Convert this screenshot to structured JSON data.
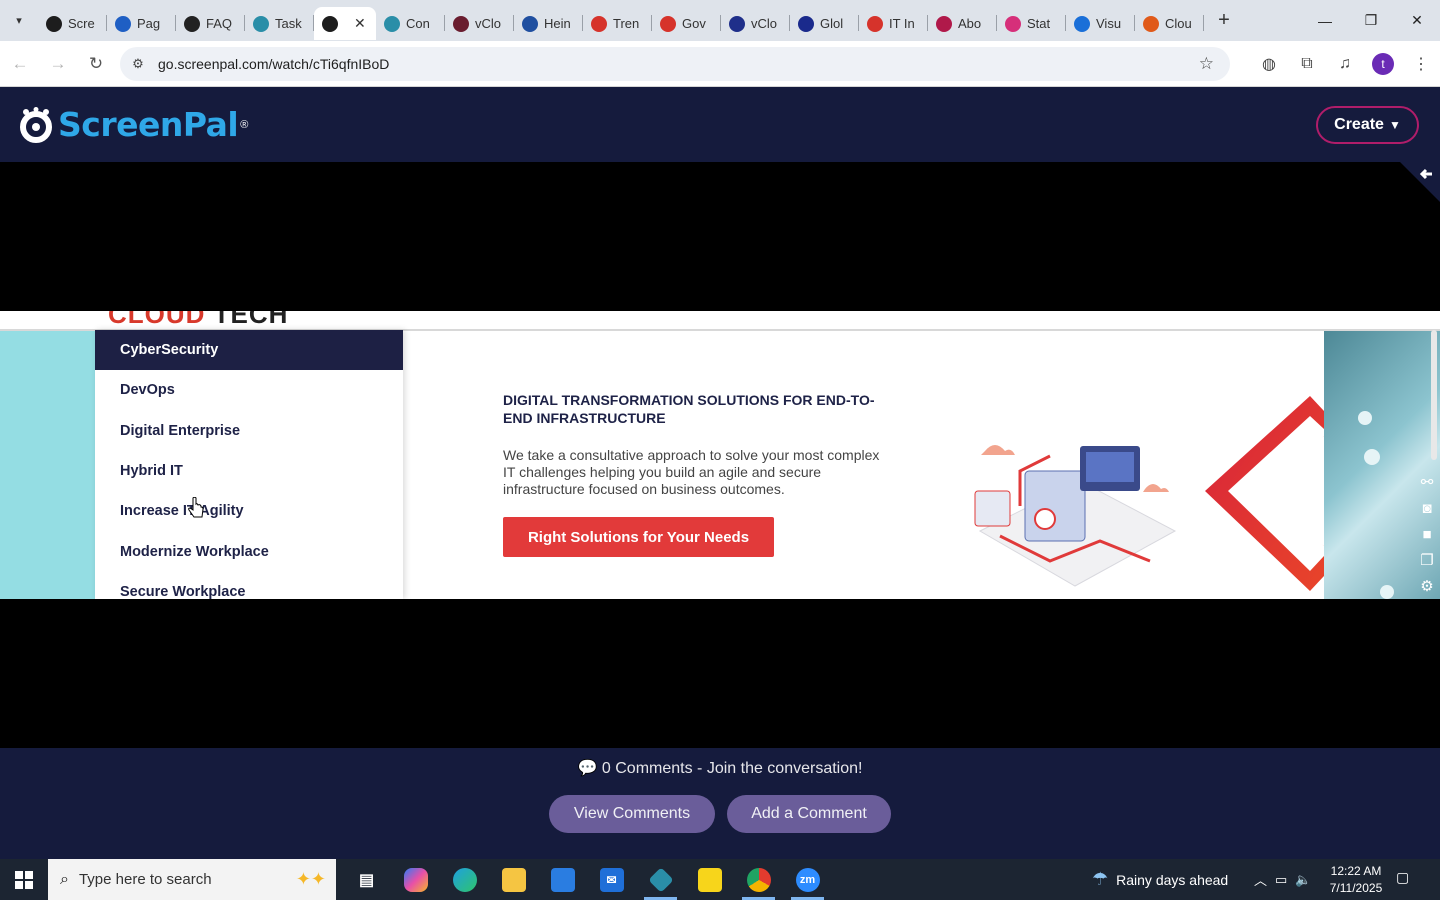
{
  "browser": {
    "tabs": [
      {
        "label": "Scre",
        "favicon": "screenpal-icon",
        "color": "#1d1d1d"
      },
      {
        "label": "Pag",
        "favicon": "gauge-icon",
        "color": "#1f5fc4"
      },
      {
        "label": "FAQ",
        "favicon": "faq-icon",
        "color": "#222222"
      },
      {
        "label": "Task",
        "favicon": "task-icon",
        "color": "#2a8ea8"
      },
      {
        "label": "",
        "favicon": "screenpal-icon",
        "color": "#1d1d1d",
        "active": true
      },
      {
        "label": "Con",
        "favicon": "hex-icon",
        "color": "#2a8ea8"
      },
      {
        "label": "vClo",
        "favicon": "v-icon",
        "color": "#6a1d2f"
      },
      {
        "label": "Hein",
        "favicon": "scale-icon",
        "color": "#1f4fa0"
      },
      {
        "label": "Tren",
        "favicon": "diamond-icon",
        "color": "#d6332b"
      },
      {
        "label": "Gov",
        "favicon": "diamond-icon",
        "color": "#d6332b"
      },
      {
        "label": "vClo",
        "favicon": "check-icon",
        "color": "#1f2f8a"
      },
      {
        "label": "Glol",
        "favicon": "x-icon",
        "color": "#1a2a8c"
      },
      {
        "label": "IT In",
        "favicon": "diamond-icon",
        "color": "#d6332b"
      },
      {
        "label": "Abo",
        "favicon": "circle-icon",
        "color": "#b0194a"
      },
      {
        "label": "Stat",
        "favicon": "quill-icon",
        "color": "#d62f7a"
      },
      {
        "label": "Visu",
        "favicon": "wave-icon",
        "color": "#1a6fd8"
      },
      {
        "label": "Clou",
        "favicon": "slash-icon",
        "color": "#e05a1a"
      }
    ],
    "url": "go.screenpal.com/watch/cTi6qfnIBoD",
    "profile_initial": "t"
  },
  "header": {
    "logo_text": "ScreenPal",
    "create_label": "Create"
  },
  "video": {
    "heading_partial_red": "CLOUD",
    "heading_partial_dark": "TECH",
    "menu_items": [
      "CyberSecurity",
      "DevOps",
      "Digital Enterprise",
      "Hybrid IT",
      "Increase IT Agility",
      "Modernize Workplace",
      "Secure Workplace"
    ],
    "active_menu_index": 0,
    "content_heading": "DIGITAL TRANSFORMATION SOLUTIONS FOR END-TO-END INFRASTRUCTURE",
    "content_body": "We take a consultative approach to solve your most complex IT challenges helping you build an agile and secure infrastructure focused on business outcomes.",
    "cta_label": "Right Solutions for Your Needs"
  },
  "comments": {
    "summary": "0 Comments - Join the conversation!",
    "view_label": "View Comments",
    "add_label": "Add a Comment"
  },
  "taskbar": {
    "search_placeholder": "Type here to search",
    "weather": "Rainy days ahead",
    "time": "12:22 AM",
    "date": "7/11/2025"
  },
  "colors": {
    "brand_navy": "#151b3d",
    "brand_blue": "#2fa8e8",
    "cta_red": "#e23a3a",
    "comment_btn": "#6a5d9a"
  }
}
